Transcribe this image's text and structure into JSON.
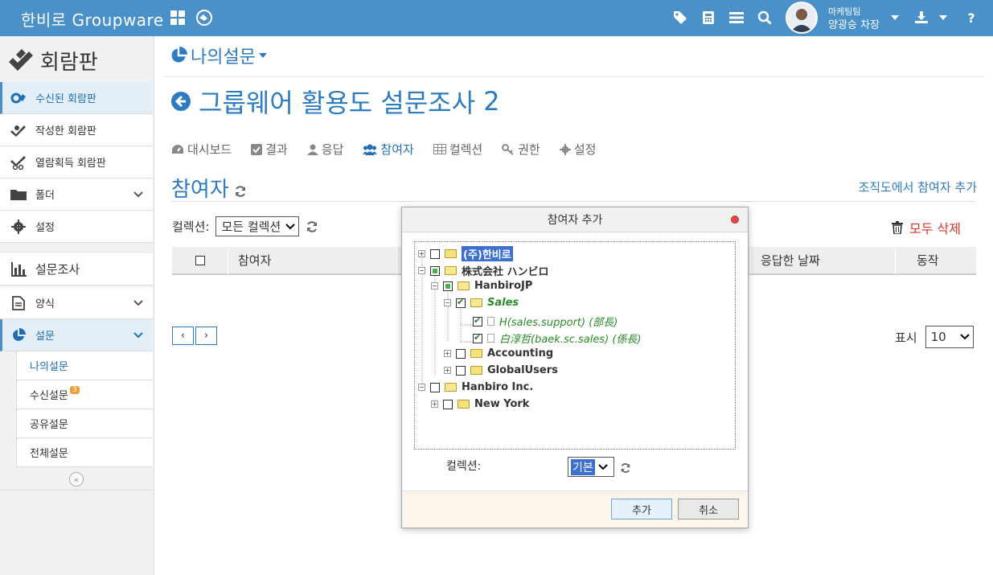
{
  "topbar": {
    "brand": "한비로 Groupware",
    "user_dept": "마케팅팀",
    "user_name": "양광승 차장",
    "help": "?"
  },
  "sidebar": {
    "title": "회람판",
    "items": [
      {
        "label": "수신된 회람판"
      },
      {
        "label": "작성한 회람판"
      },
      {
        "label": "열람획득 회람판"
      },
      {
        "label": "폴더"
      },
      {
        "label": "설정"
      }
    ],
    "survey_title": "설문조사",
    "survey_items": [
      {
        "label": "양식"
      },
      {
        "label": "설문"
      }
    ],
    "sub_items": [
      {
        "label": "나의설문"
      },
      {
        "label": "수신설문",
        "badge": "3"
      },
      {
        "label": "공유설문"
      },
      {
        "label": "전체설문"
      }
    ]
  },
  "main": {
    "page_head": "나의설문",
    "survey_title": "그룹웨어 활용도 설문조사",
    "survey_num": "2",
    "tabs": [
      {
        "label": "대시보드"
      },
      {
        "label": "결과"
      },
      {
        "label": "응답"
      },
      {
        "label": "참여자"
      },
      {
        "label": "컬렉션"
      },
      {
        "label": "권한"
      },
      {
        "label": "설정"
      }
    ],
    "section_title": "참여자",
    "add_link": "조직도에서 참여자 추가",
    "collection_label": "컬렉션:",
    "collection_value": "모든 컬렉션",
    "delete_all": "모두 삭제",
    "columns": [
      "참여자",
      "응답한 날짜",
      "동작"
    ],
    "prev": "‹",
    "next": "›",
    "show_label": "표시",
    "show_value": "10"
  },
  "modal": {
    "title": "참여자 추가",
    "tree": [
      {
        "label": "(주)한비로"
      },
      {
        "label": "株式会社 ハンビロ"
      },
      {
        "label": "HanbiroJP"
      },
      {
        "label": "Sales"
      },
      {
        "label": "H(sales.support) (部長)"
      },
      {
        "label": "白淳哲(baek.sc.sales) (係長)"
      },
      {
        "label": "Accounting"
      },
      {
        "label": "GlobalUsers"
      },
      {
        "label": "Hanbiro Inc."
      },
      {
        "label": "New York"
      }
    ],
    "collection_label": "컬렉션:",
    "collection_value": "기본",
    "add_button": "추가",
    "cancel_button": "취소"
  }
}
